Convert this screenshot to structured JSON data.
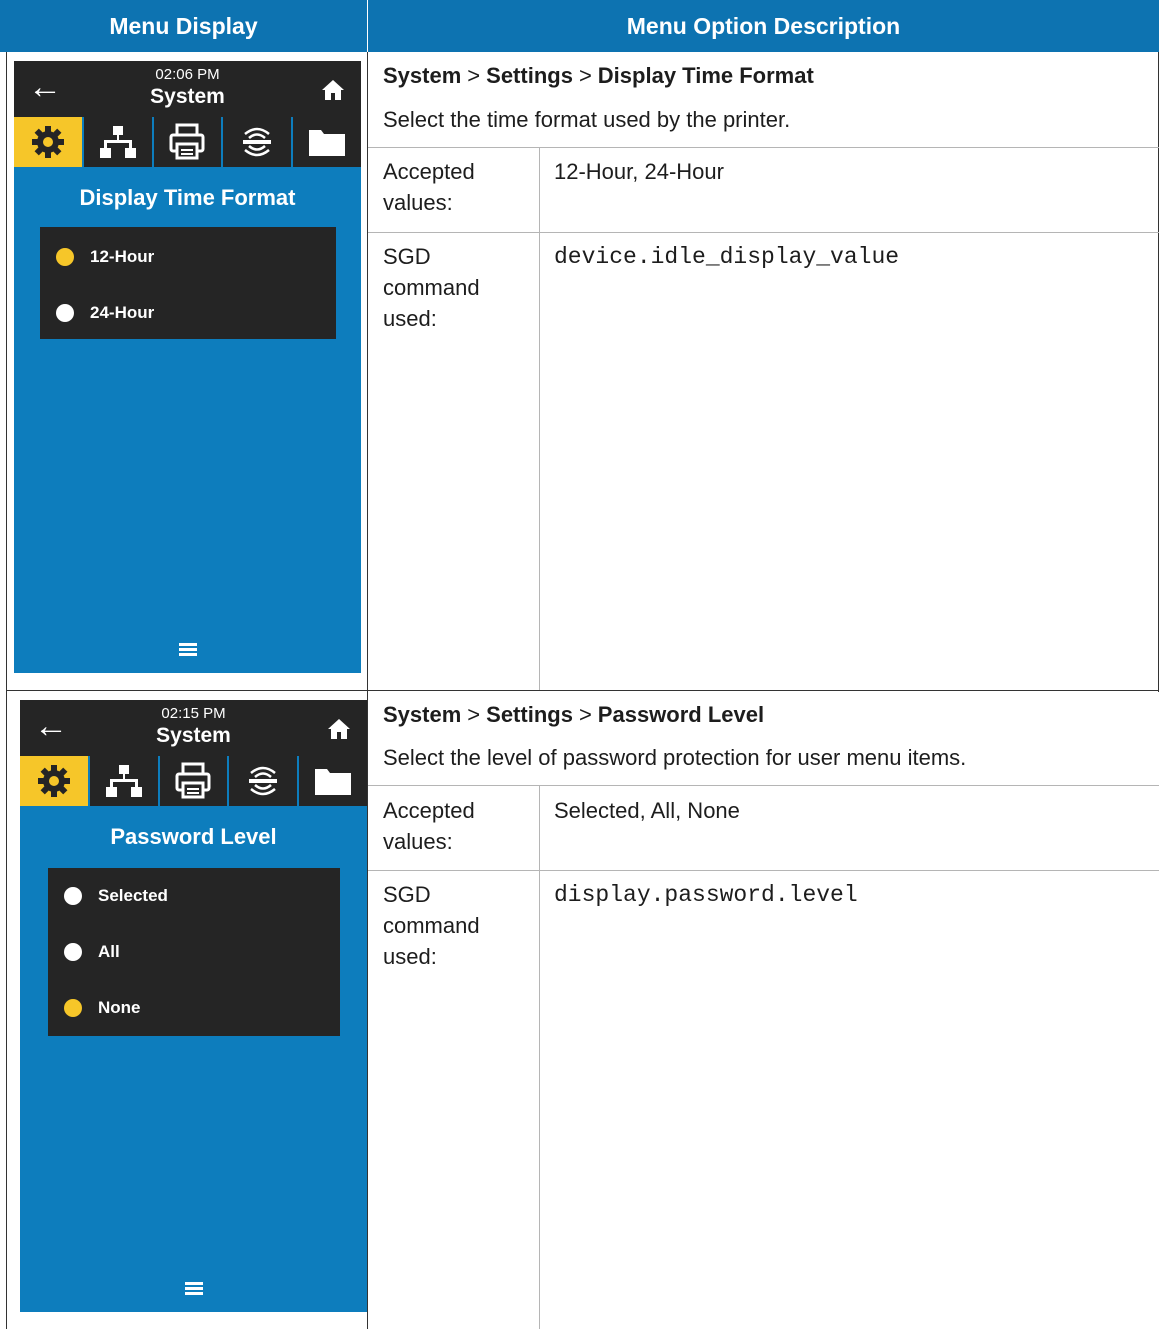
{
  "header": {
    "left": "Menu Display",
    "right": "Menu Option Description"
  },
  "rows": [
    {
      "device": {
        "time": "02:06 PM",
        "title": "System",
        "screen_title": "Display Time Format",
        "options": [
          {
            "label": "12-Hour",
            "selected": true
          },
          {
            "label": "24-Hour",
            "selected": false
          }
        ]
      },
      "breadcrumb": {
        "p1": "System",
        "p2": "Settings",
        "p3": "Display Time Format",
        "sep": ">"
      },
      "description": "Select the time format used by the printer.",
      "accepted_label": "Accepted values:",
      "accepted_value": "12-Hour, 24-Hour",
      "sgd_label": "SGD command used:",
      "sgd_value": "device.idle_display_value"
    },
    {
      "device": {
        "time": "02:15 PM",
        "title": "System",
        "screen_title": "Password Level",
        "options": [
          {
            "label": "Selected",
            "selected": false
          },
          {
            "label": "All",
            "selected": false
          },
          {
            "label": "None",
            "selected": true
          }
        ]
      },
      "breadcrumb": {
        "p1": "System",
        "p2": "Settings",
        "p3": "Password Level",
        "sep": ">"
      },
      "description": "Select the level of password protection for user menu items.",
      "accepted_label": "Accepted values:",
      "accepted_value": "Selected, All, None",
      "sgd_label": "SGD command used:",
      "sgd_value": "display.password.level"
    }
  ],
  "colors": {
    "header_blue": "#0d73b1",
    "screen_blue": "#0d7dbd",
    "dark": "#252525",
    "accent_yellow": "#f6c629"
  },
  "icons": [
    "back-arrow-icon",
    "home-icon",
    "gear-icon",
    "network-icon",
    "printer-icon",
    "wireless-icon",
    "folder-icon",
    "menu-icon"
  ]
}
